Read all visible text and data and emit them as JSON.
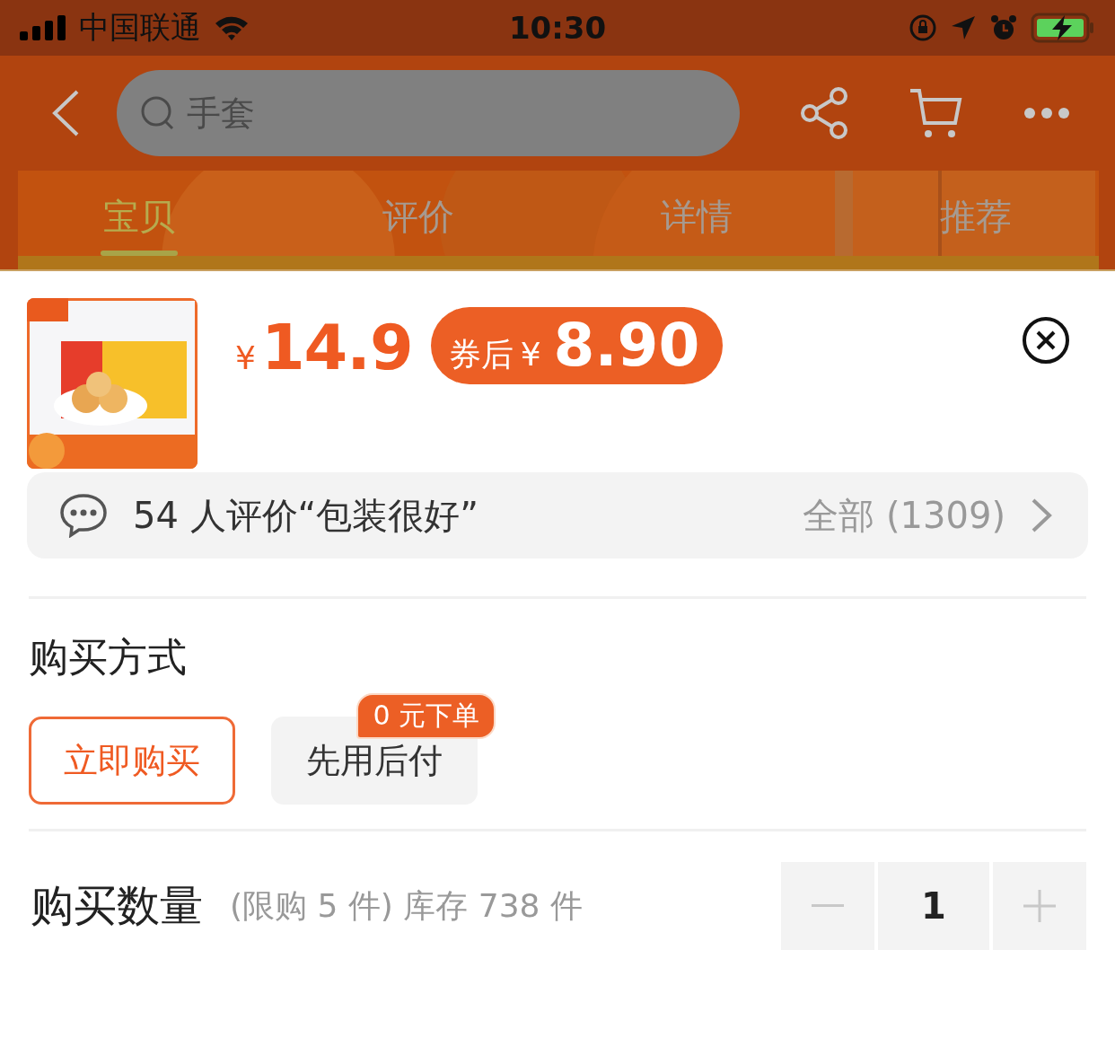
{
  "status_bar": {
    "carrier": "中国联通",
    "time": "10:30"
  },
  "nav": {
    "search_placeholder": "手套"
  },
  "tabs": [
    {
      "label": "宝贝",
      "selected": true
    },
    {
      "label": "评价",
      "selected": false
    },
    {
      "label": "详情",
      "selected": false
    },
    {
      "label": "推荐",
      "selected": false
    }
  ],
  "product": {
    "price_symbol": "¥",
    "price": "14.9",
    "coupon_label": "券后",
    "coupon_symbol": "¥",
    "coupon_price": "8.90"
  },
  "review_bar": {
    "summary": "54 人评价“包装很好”",
    "all": "全部 (1309)"
  },
  "purchase_method": {
    "title": "购买方式",
    "options": [
      {
        "label": "立即购买",
        "selected": true
      },
      {
        "label": "先用后付",
        "selected": false,
        "badge": "0 元下单"
      }
    ]
  },
  "quantity": {
    "title": "购买数量",
    "limit": "(限购 5 件) 库存 738 件",
    "value": "1",
    "minus_disabled": true,
    "plus_disabled": true
  }
}
